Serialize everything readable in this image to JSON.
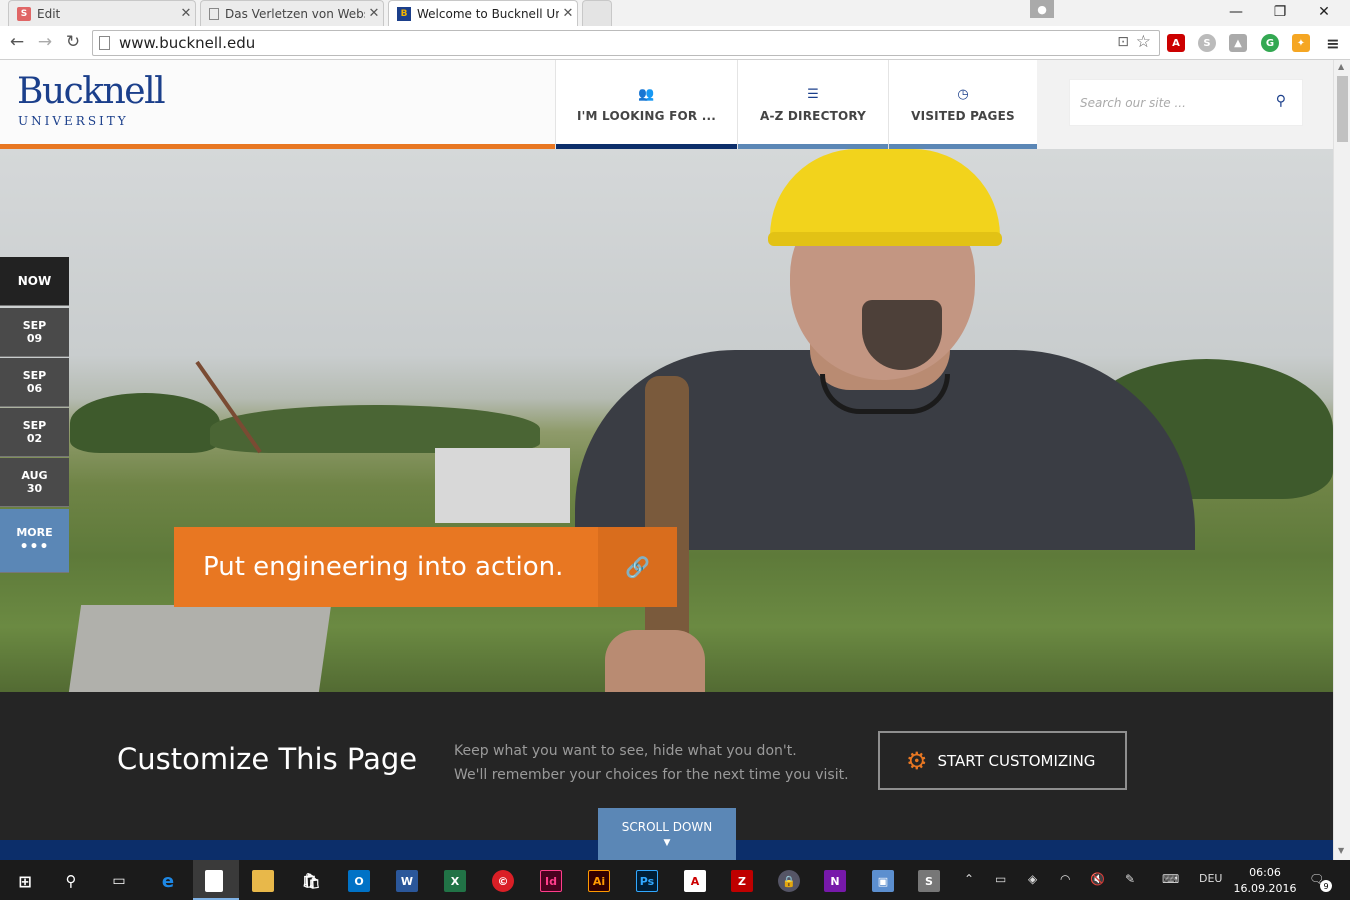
{
  "browser": {
    "tabs": [
      {
        "title": "Edit",
        "favicon": "S"
      },
      {
        "title": "Das Verletzen von Website",
        "favicon": ""
      },
      {
        "title": "Welcome to Bucknell Univ",
        "favicon": "B"
      }
    ],
    "url": "www.bucknell.edu"
  },
  "header": {
    "logo_main": "Bucknell",
    "logo_sub": "UNIVERSITY",
    "nav": [
      {
        "label": "I'M LOOKING FOR ...",
        "icon": "people-icon"
      },
      {
        "label": "A-Z DIRECTORY",
        "icon": "list-icon"
      },
      {
        "label": "VISITED PAGES",
        "icon": "clock-icon"
      }
    ],
    "search_placeholder": "Search our site ..."
  },
  "events": [
    {
      "month": "NOW",
      "day": ""
    },
    {
      "month": "SEP",
      "day": "09"
    },
    {
      "month": "SEP",
      "day": "06"
    },
    {
      "month": "SEP",
      "day": "02"
    },
    {
      "month": "AUG",
      "day": "30"
    }
  ],
  "events_more": "MORE",
  "hero": {
    "cta_text": "Put engineering into action."
  },
  "customize": {
    "title": "Customize This Page",
    "desc_line1": "Keep what you want to see, hide what you don't.",
    "desc_line2": "We'll remember your choices for the next time you visit.",
    "button_label": "START CUSTOMIZING",
    "scroll_down": "SCROLL DOWN"
  },
  "taskbar": {
    "language": "DEU",
    "time": "06:06",
    "date": "16.09.2016",
    "notifications": "9"
  },
  "colors": {
    "accent_orange": "#e87722",
    "brand_blue": "#1b3f8b",
    "nav_blue": "#5b87b6",
    "dark_band": "#252525"
  }
}
